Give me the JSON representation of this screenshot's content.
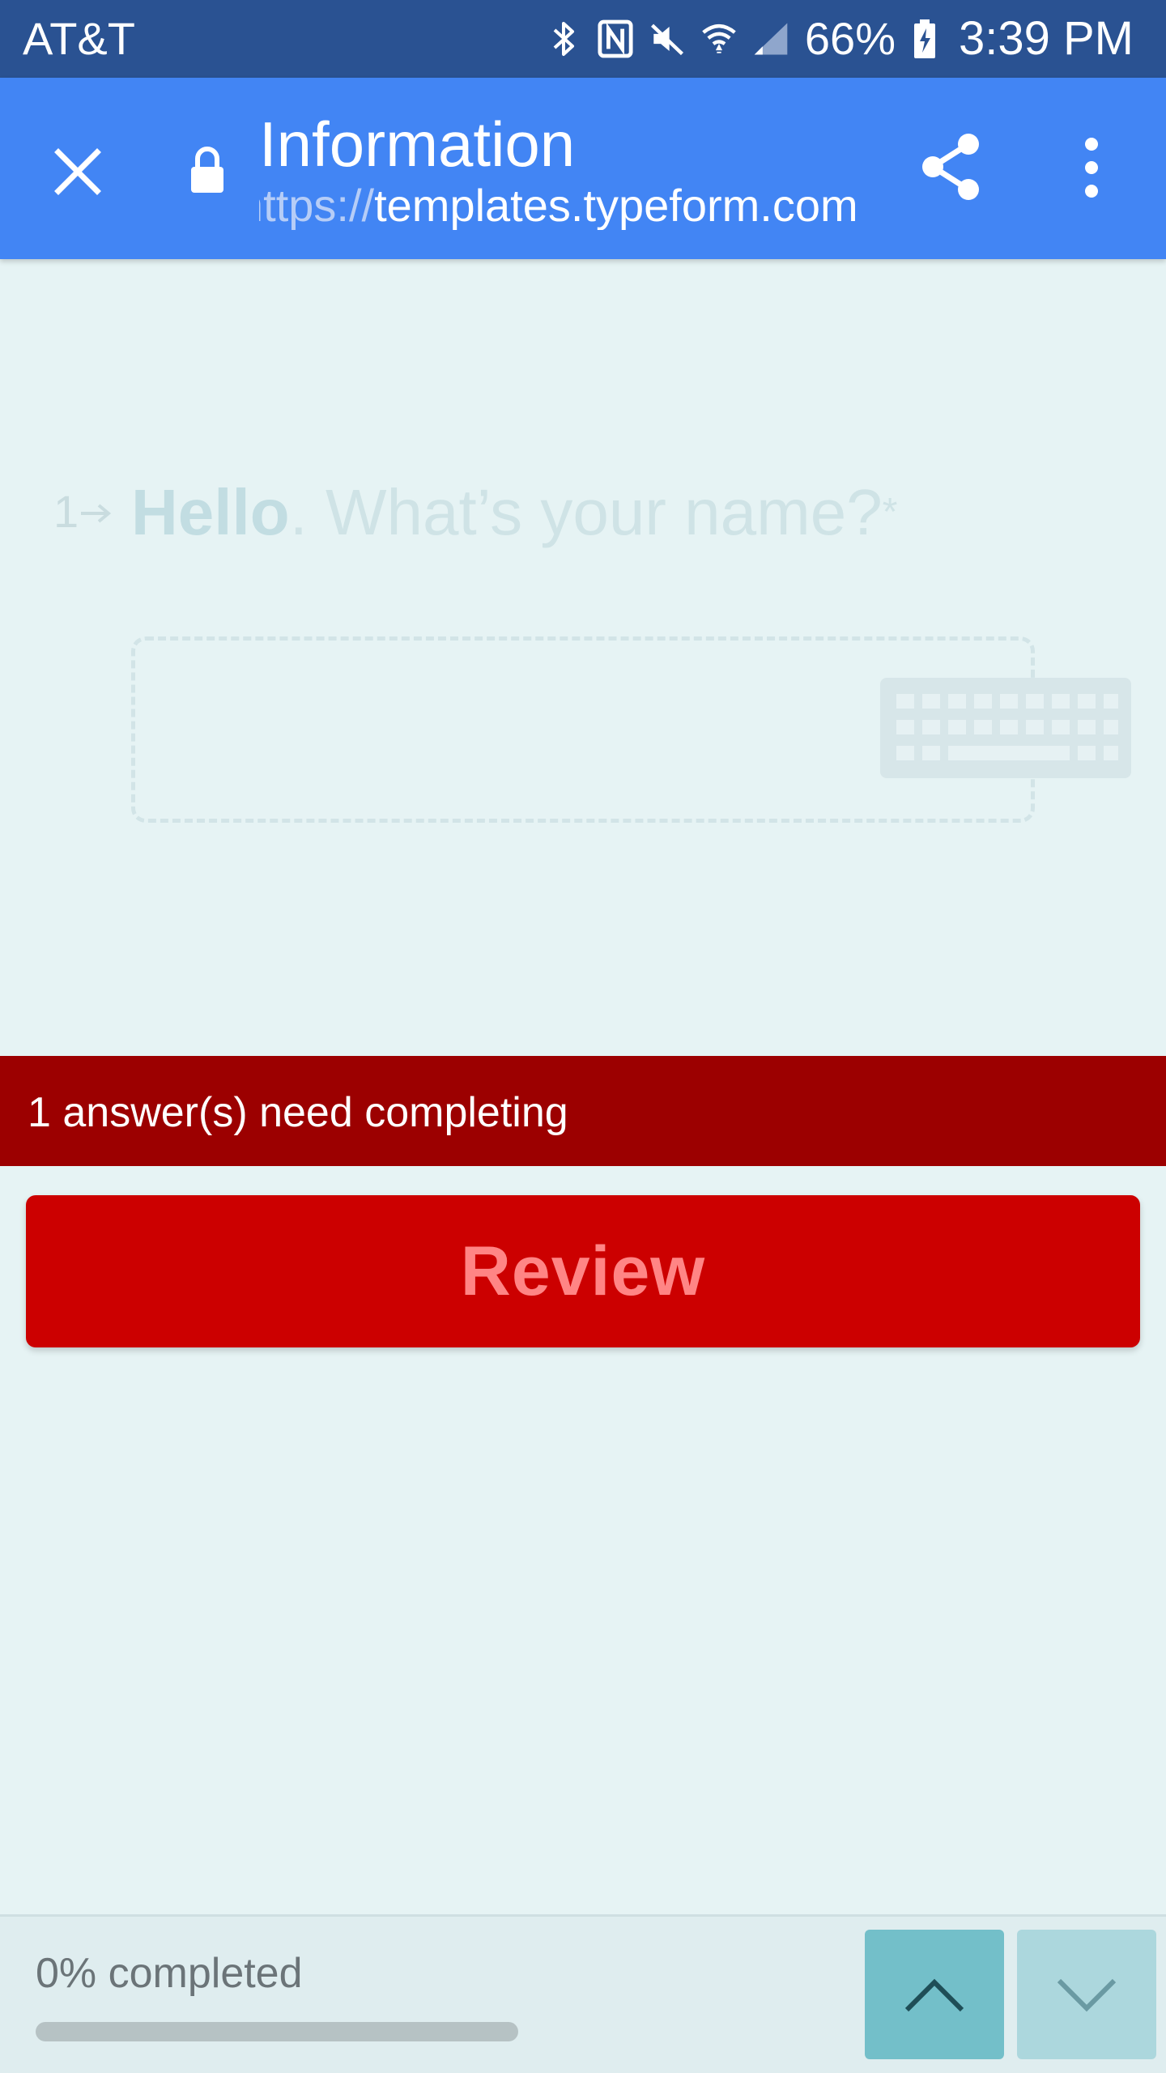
{
  "status_bar": {
    "carrier": "AT&T",
    "battery": "66%",
    "time": "3:39 PM",
    "icons": [
      "bluetooth-icon",
      "nfc-icon",
      "mute-icon",
      "wifi-icon",
      "signal-icon",
      "battery-charging-icon"
    ]
  },
  "toolbar": {
    "title": "Information",
    "url_scheme": "https://",
    "url_host": "templates.typeform.com",
    "icons": [
      "close-icon",
      "lock-icon",
      "share-icon",
      "more-vert-icon"
    ]
  },
  "question": {
    "number": "1",
    "text_bold": "Hello",
    "text_rest": ". What’s your name?",
    "required_mark": "*",
    "answer_value": "",
    "keyboard_icon": "keyboard-icon"
  },
  "error": {
    "message": "1 answer(s) need completing"
  },
  "review_button": {
    "label": "Review"
  },
  "footer": {
    "progress_label": "0% completed",
    "progress_fraction": 0.0,
    "nav_icons": [
      "chevron-up-icon",
      "chevron-down-icon"
    ]
  },
  "colors": {
    "status_bar": "#2a5292",
    "toolbar": "#4285f4",
    "background": "#e6f3f4",
    "error_bar": "#9c0000",
    "review_button": "#cc0000",
    "review_text": "#ff8585",
    "nav_up": "#73bfc9",
    "nav_down": "#acd7dd"
  }
}
